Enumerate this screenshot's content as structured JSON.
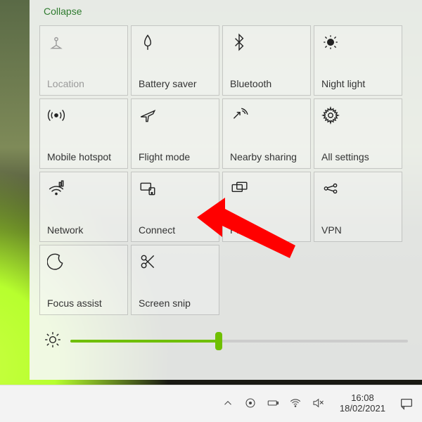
{
  "action_center": {
    "collapse_label": "Collapse",
    "tiles": [
      {
        "id": "location",
        "label": "Location",
        "disabled": true
      },
      {
        "id": "battery-saver",
        "label": "Battery saver",
        "disabled": false
      },
      {
        "id": "bluetooth",
        "label": "Bluetooth",
        "disabled": false
      },
      {
        "id": "night-light",
        "label": "Night light",
        "disabled": false
      },
      {
        "id": "mobile-hotspot",
        "label": "Mobile hotspot",
        "disabled": false
      },
      {
        "id": "flight-mode",
        "label": "Flight mode",
        "disabled": false
      },
      {
        "id": "nearby-sharing",
        "label": "Nearby sharing",
        "disabled": false
      },
      {
        "id": "all-settings",
        "label": "All settings",
        "disabled": false
      },
      {
        "id": "network",
        "label": "Network",
        "disabled": false
      },
      {
        "id": "connect",
        "label": "Connect",
        "disabled": false
      },
      {
        "id": "project",
        "label": "Project",
        "disabled": false
      },
      {
        "id": "vpn",
        "label": "VPN",
        "disabled": false
      },
      {
        "id": "focus-assist",
        "label": "Focus assist",
        "disabled": false
      },
      {
        "id": "screen-snip",
        "label": "Screen snip",
        "disabled": false
      }
    ],
    "brightness_percent": 44
  },
  "taskbar": {
    "time": "16:08",
    "date": "18/02/2021"
  },
  "annotation": {
    "arrow_target": "connect"
  },
  "colors": {
    "accent": "#6fbf00",
    "link": "#2f7b2f",
    "annotation": "#ff0000"
  }
}
